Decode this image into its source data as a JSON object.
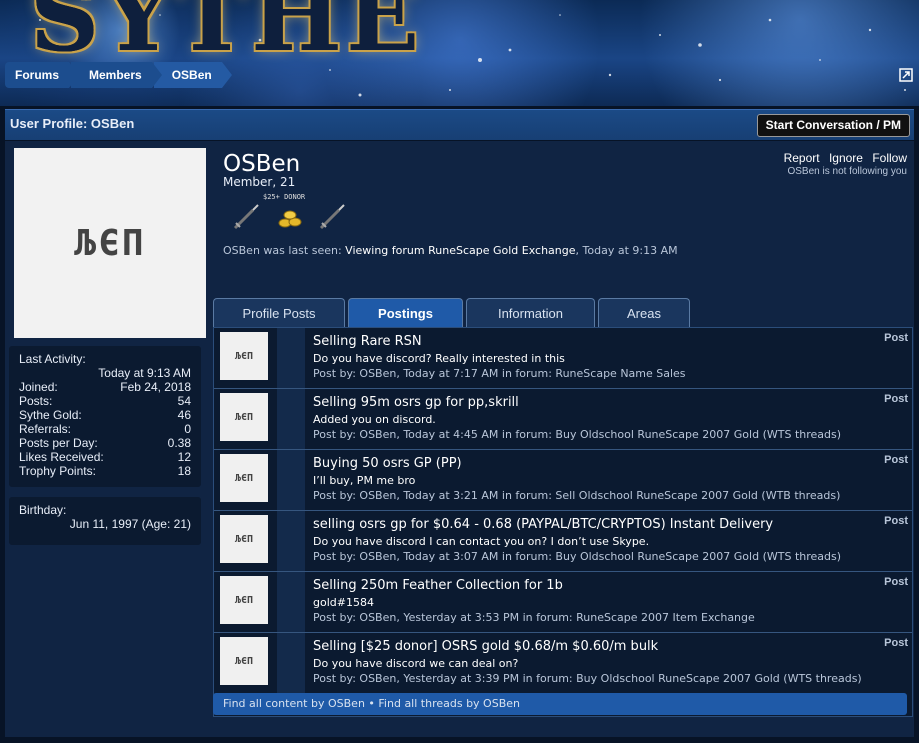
{
  "banner": {
    "logo_text": "SYTHE"
  },
  "breadcrumb": [
    {
      "label": "Forums"
    },
    {
      "label": "Members"
    },
    {
      "label": "OSBen"
    }
  ],
  "header": {
    "title": "User Profile: OSBen",
    "pm_button": "Start Conversation / PM"
  },
  "profile": {
    "avatar_text": "ЉЄП",
    "username": "OSBen",
    "user_title": "Member, 21",
    "badge_label": "$25+ DONOR",
    "last_seen_prefix": "OSBen was last seen:",
    "last_seen_action": "Viewing forum",
    "last_seen_forum": "RuneScape Gold Exchange",
    "last_seen_time": ", Today at 9:13 AM",
    "actions": {
      "report": "Report",
      "ignore": "Ignore",
      "follow": "Follow"
    },
    "follow_status": "OSBen is not following you"
  },
  "stats": {
    "last_activity_label": "Last Activity:",
    "last_activity_value": "Today at 9:13 AM",
    "rows": [
      {
        "label": "Joined:",
        "value": "Feb 24, 2018"
      },
      {
        "label": "Posts:",
        "value": "54"
      },
      {
        "label": "Sythe Gold:",
        "value": "46"
      },
      {
        "label": "Referrals:",
        "value": "0"
      },
      {
        "label": "Posts per Day:",
        "value": "0.38"
      },
      {
        "label": "Likes Received:",
        "value": "12"
      },
      {
        "label": "Trophy Points:",
        "value": "18"
      }
    ],
    "birthday_label": "Birthday:",
    "birthday_value": "Jun 11, 1997 (Age: 21)"
  },
  "tabs": [
    {
      "label": "Profile Posts",
      "active": false
    },
    {
      "label": "Postings",
      "active": true
    },
    {
      "label": "Information",
      "active": false
    },
    {
      "label": "Areas",
      "active": false
    }
  ],
  "posts": [
    {
      "thumb": "ЉЄП",
      "title": "Selling Rare RSN",
      "snippet": "Do you have discord? Really interested in this",
      "meta": "Post by: OSBen, Today at 7:17 AM in forum: RuneScape Name Sales",
      "kind": "Post"
    },
    {
      "thumb": "ЉЄП",
      "title": "Selling 95m osrs gp for pp,skrill",
      "snippet": "Added you on discord.",
      "meta": "Post by: OSBen, Today at 4:45 AM in forum: Buy Oldschool RuneScape 2007 Gold (WTS threads)",
      "kind": "Post"
    },
    {
      "thumb": "ЉЄП",
      "title": "Buying 50 osrs GP (PP)",
      "snippet": "I’ll buy, PM me bro",
      "meta": "Post by: OSBen, Today at 3:21 AM in forum: Sell Oldschool RuneScape 2007 Gold (WTB threads)",
      "kind": "Post"
    },
    {
      "thumb": "ЉЄП",
      "title": "selling osrs gp for $0.64 - 0.68 (PAYPAL/BTC/CRYPTOS) Instant Delivery",
      "snippet": "Do you have discord I can contact you on? I don’t use Skype.",
      "meta": "Post by: OSBen, Today at 3:07 AM in forum: Buy Oldschool RuneScape 2007 Gold (WTS threads)",
      "kind": "Post"
    },
    {
      "thumb": "ЉЄП",
      "title": "Selling 250m Feather Collection for 1b",
      "snippet": "gold#1584",
      "meta": "Post by: OSBen, Yesterday at 3:53 PM in forum: RuneScape 2007 Item Exchange",
      "kind": "Post"
    },
    {
      "thumb": "ЉЄП",
      "title": "Selling [$25 donor] OSRS gold $0.68/m $0.60/m bulk",
      "snippet": "Do you have discord we can deal on?",
      "meta": "Post by: OSBen, Yesterday at 3:39 PM in forum: Buy Oldschool RuneScape 2007 Gold (WTS threads)",
      "kind": "Post"
    }
  ],
  "footer_links": {
    "find_content": "Find all content by OSBen",
    "separator": " • ",
    "find_threads": "Find all threads by OSBen"
  }
}
